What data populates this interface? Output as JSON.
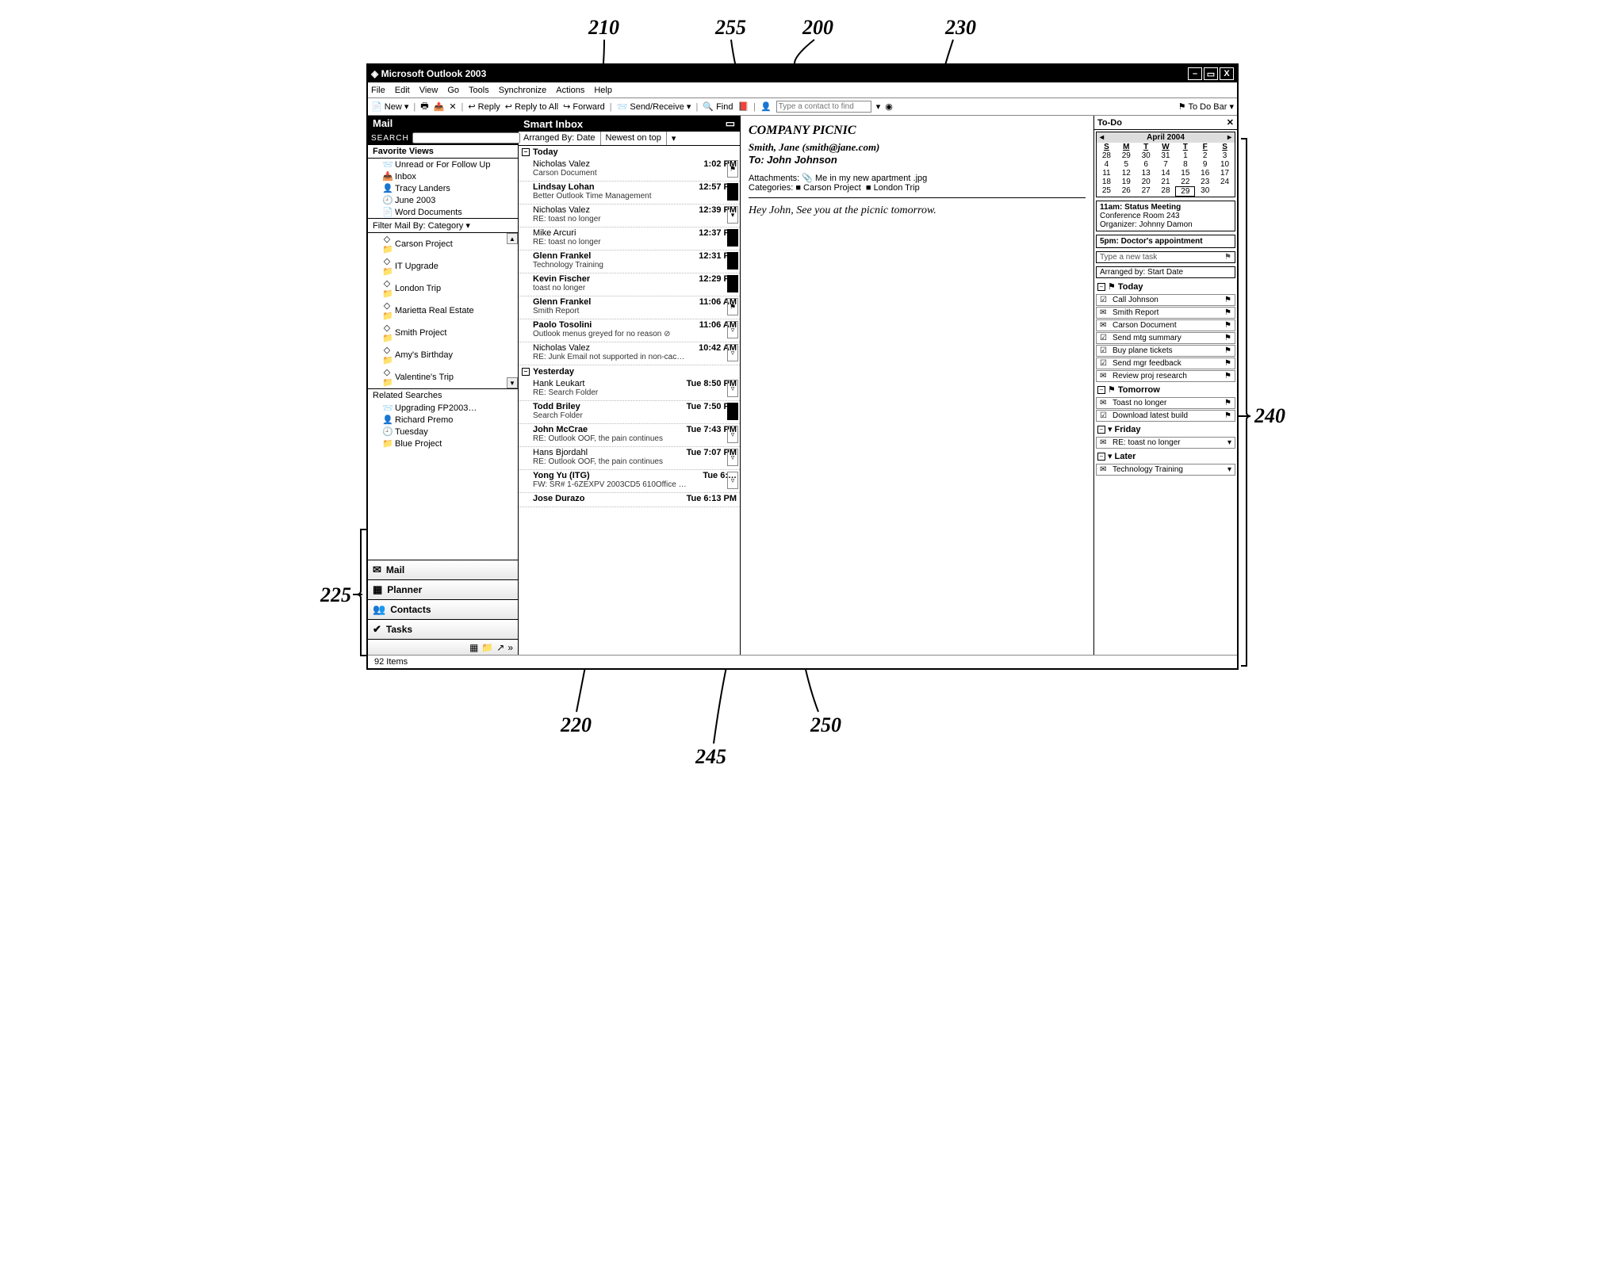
{
  "callouts": {
    "c200": "200",
    "c210": "210",
    "c220": "220",
    "c225": "225",
    "c230": "230",
    "c240": "240",
    "c245": "245",
    "c250": "250",
    "c255": "255"
  },
  "title": "Microsoft Outlook 2003",
  "menu": [
    "File",
    "Edit",
    "View",
    "Go",
    "Tools",
    "Synchronize",
    "Actions",
    "Help"
  ],
  "toolbar": {
    "new": "New",
    "reply": "Reply",
    "replyall": "Reply to All",
    "forward": "Forward",
    "sendrecv": "Send/Receive",
    "find": "Find",
    "find_placeholder": "Type a contact to find",
    "todobar": "To Do Bar"
  },
  "nav": {
    "header": "Mail",
    "search": "SEARCH",
    "fav_header": "Favorite Views",
    "fav_items": [
      {
        "ic": "📨",
        "label": "Unread or For Follow Up"
      },
      {
        "ic": "📥",
        "label": "Inbox"
      },
      {
        "ic": "👤",
        "label": "Tracy Landers"
      },
      {
        "ic": "🕘",
        "label": "June 2003"
      },
      {
        "ic": "📄",
        "label": "Word Documents"
      }
    ],
    "filter_label": "Filter Mail By: Category ▾",
    "categories": [
      {
        "label": "Carson Project"
      },
      {
        "label": "IT Upgrade"
      },
      {
        "label": "London Trip"
      },
      {
        "label": "Marietta Real Estate"
      },
      {
        "label": "Smith Project"
      },
      {
        "label": "Amy's Birthday"
      },
      {
        "label": "Valentine's Trip"
      }
    ],
    "related_header": "Related Searches",
    "related_items": [
      {
        "ic": "📨",
        "label": "Upgrading FP2003…"
      },
      {
        "ic": "👤",
        "label": "Richard Premo"
      },
      {
        "ic": "🕘",
        "label": "Tuesday"
      },
      {
        "ic": "📁",
        "label": "Blue Project"
      }
    ],
    "tabs": [
      {
        "ic": "✉",
        "label": "Mail"
      },
      {
        "ic": "▦",
        "label": "Planner"
      },
      {
        "ic": "👥",
        "label": "Contacts"
      },
      {
        "ic": "✔",
        "label": "Tasks"
      }
    ]
  },
  "inbox": {
    "header": "Smart Inbox",
    "arr_by": "Arranged By: Date",
    "arr_order": "Newest on top",
    "groups": [
      {
        "label": "Today",
        "messages": [
          {
            "from": "Nicholas Valez",
            "time": "1:02 PM",
            "subj": "Carson Document",
            "flag": "⚑"
          },
          {
            "from": "Lindsay Lohan",
            "time": "12:57 PM",
            "subj": "Better Outlook Time Management",
            "bold": true,
            "flag": "dark"
          },
          {
            "from": "Nicholas Valez",
            "time": "12:39 PM",
            "subj": "RE: toast no longer",
            "flag": "▾"
          },
          {
            "from": "Mike Arcuri",
            "time": "12:37 PM",
            "subj": "RE: toast no longer",
            "flag": "dark"
          },
          {
            "from": "Glenn Frankel",
            "time": "12:31 PM",
            "subj": "Technology Training",
            "bold": true,
            "flag": "dark"
          },
          {
            "from": "Kevin Fischer",
            "time": "12:29 PM",
            "subj": "toast no longer",
            "bold": true,
            "flag": "dark"
          },
          {
            "from": "Glenn Frankel",
            "time": "11:06 AM",
            "subj": "Smith Report",
            "bold": true,
            "flag": "⚑"
          },
          {
            "from": "Paolo Tosolini",
            "time": "11:06 AM",
            "subj": "Outlook menus greyed for no reason   ⊘",
            "bold": true,
            "flag": "▿"
          },
          {
            "from": "Nicholas Valez",
            "time": "10:42 AM",
            "subj": "RE: Junk Email not supported in non-cac…",
            "flag": "▿"
          }
        ]
      },
      {
        "label": "Yesterday",
        "messages": [
          {
            "from": "Hank Leukart",
            "time": "Tue 8:50 PM",
            "subj": "RE: Search Folder",
            "flag": "▿"
          },
          {
            "from": "Todd Briley",
            "time": "Tue 7:50 PM",
            "subj": "Search Folder",
            "bold": true,
            "flag": "dark"
          },
          {
            "from": "John McCrae",
            "time": "Tue 7:43 PM",
            "subj": "RE: Outlook OOF, the pain continues",
            "bold": true,
            "flag": "▿"
          },
          {
            "from": "Hans Bjordahl",
            "time": "Tue 7:07 PM",
            "subj": "RE: Outlook OOF, the pain continues",
            "flag": "▿"
          },
          {
            "from": "Yong Yu (ITG)",
            "time": "Tue 6:…",
            "subj": "FW: SR# 1-6ZEXPV 2003CD5 610Office …",
            "bold": true,
            "flag": "▿"
          },
          {
            "from": "Jose Durazo",
            "time": "Tue 6:13 PM",
            "subj": "",
            "bold": true
          }
        ]
      }
    ]
  },
  "reading": {
    "subject": "COMPANY PICNIC",
    "from": "Smith, Jane (smith@jane.com)",
    "to_label": "To:",
    "to": "John Johnson",
    "att_label": "Attachments:",
    "attachment": "Me in my new apartment .jpg",
    "cat_label": "Categories:",
    "cat1": "Carson Project",
    "cat2": "London Trip",
    "body": "Hey John, See you at the picnic tomorrow."
  },
  "todo": {
    "header": "To-Do",
    "cal_title": "April 2004",
    "dow": [
      "S",
      "M",
      "T",
      "W",
      "T",
      "F",
      "S"
    ],
    "weeks": [
      [
        "28",
        "29",
        "30",
        "31",
        "1",
        "2",
        "3"
      ],
      [
        "4",
        "5",
        "6",
        "7",
        "8",
        "9",
        "10"
      ],
      [
        "11",
        "12",
        "13",
        "14",
        "15",
        "16",
        "17"
      ],
      [
        "18",
        "19",
        "20",
        "21",
        "22",
        "23",
        "24"
      ],
      [
        "25",
        "26",
        "27",
        "28",
        "29",
        "30",
        ""
      ]
    ],
    "appt1": {
      "title": "11am: Status Meeting",
      "line2": "Conference Room 243",
      "line3": "Organizer: Johnny Damon"
    },
    "appt2": {
      "title": "5pm: Doctor's appointment"
    },
    "newtask": "Type a new task",
    "arranged": "Arranged by: Start Date",
    "groups": [
      {
        "label": "Today",
        "icon": "⚑",
        "items": [
          {
            "ic": "☑",
            "txt": "Call Johnson",
            "flag": "⚑"
          },
          {
            "ic": "✉",
            "txt": "Smith Report",
            "flag": "⚑"
          },
          {
            "ic": "✉",
            "txt": "Carson Document",
            "flag": "⚑"
          },
          {
            "ic": "☑",
            "txt": "Send mtg summary",
            "flag": "⚑"
          },
          {
            "ic": "☑",
            "txt": "Buy plane tickets",
            "flag": "⚑"
          },
          {
            "ic": "☑",
            "txt": "Send mgr feedback",
            "flag": "⚑"
          },
          {
            "ic": "✉",
            "txt": "Review proj research",
            "flag": "⚑"
          }
        ]
      },
      {
        "label": "Tomorrow",
        "icon": "⚑",
        "items": [
          {
            "ic": "✉",
            "txt": "Toast no longer",
            "flag": "⚑"
          },
          {
            "ic": "☑",
            "txt": "Download latest build",
            "flag": "⚑"
          }
        ]
      },
      {
        "label": "Friday",
        "icon": "▾",
        "items": [
          {
            "ic": "✉",
            "txt": "RE: toast no longer",
            "flag": "▾"
          }
        ]
      },
      {
        "label": "Later",
        "icon": "▾",
        "items": [
          {
            "ic": "✉",
            "txt": "Technology Training",
            "flag": "▾"
          }
        ]
      }
    ]
  },
  "status": "92 Items"
}
